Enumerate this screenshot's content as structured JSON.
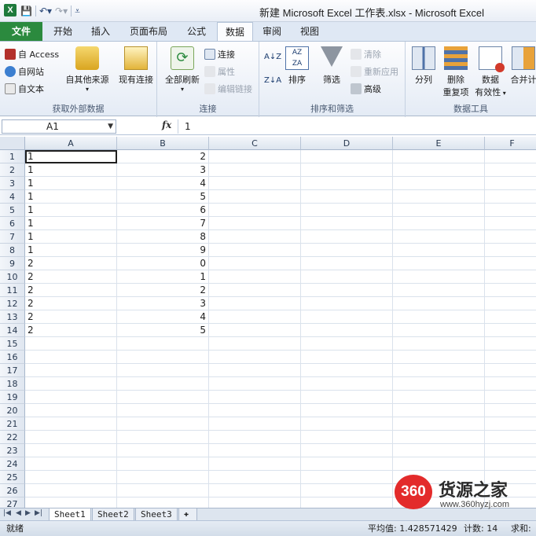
{
  "window": {
    "title": "新建 Microsoft Excel 工作表.xlsx - Microsoft Excel",
    "app_icon": "X"
  },
  "quick_access": {
    "save_icon": "save-icon",
    "undo_icon": "undo-icon",
    "redo_icon": "redo-icon",
    "customize_icon": "customize-qat-icon"
  },
  "ribbon_tabs": [
    {
      "label": "文件"
    },
    {
      "label": "开始"
    },
    {
      "label": "插入"
    },
    {
      "label": "页面布局"
    },
    {
      "label": "公式"
    },
    {
      "label": "数据"
    },
    {
      "label": "审阅"
    },
    {
      "label": "视图"
    }
  ],
  "ribbon": {
    "external": {
      "label": "获取外部数据",
      "access": "自 Access",
      "web": "自网站",
      "text": "自文本",
      "other": "自其他来源",
      "existing": "现有连接"
    },
    "connections": {
      "label": "连接",
      "refresh_all": "全部刷新",
      "connections": "连接",
      "properties": "属性",
      "edit_links": "编辑链接"
    },
    "sort_filter": {
      "label": "排序和筛选",
      "sort_asc": "A↓Z",
      "sort_desc": "Z↓A",
      "sort": "排序",
      "filter": "筛选",
      "clear": "清除",
      "reapply": "重新应用",
      "advanced": "高级"
    },
    "data_tools": {
      "label": "数据工具",
      "split": "分列",
      "remove_dup_1": "删除",
      "remove_dup_2": "重复项",
      "validation_1": "数据",
      "validation_2": "有效性",
      "consolidate": "合并计"
    }
  },
  "formula_bar": {
    "name_box": "A1",
    "fx": "fx",
    "value": "1"
  },
  "sheet": {
    "columns": [
      "A",
      "B",
      "C",
      "D",
      "E",
      "F"
    ],
    "rows": [
      {
        "n": "1",
        "a": "1",
        "b": "2"
      },
      {
        "n": "2",
        "a": "1",
        "b": "3"
      },
      {
        "n": "3",
        "a": "1",
        "b": "4"
      },
      {
        "n": "4",
        "a": "1",
        "b": "5"
      },
      {
        "n": "5",
        "a": "1",
        "b": "6"
      },
      {
        "n": "6",
        "a": "1",
        "b": "7"
      },
      {
        "n": "7",
        "a": "1",
        "b": "8"
      },
      {
        "n": "8",
        "a": "1",
        "b": "9"
      },
      {
        "n": "9",
        "a": "2",
        "b": "0"
      },
      {
        "n": "10",
        "a": "2",
        "b": "1"
      },
      {
        "n": "11",
        "a": "2",
        "b": "2"
      },
      {
        "n": "12",
        "a": "2",
        "b": "3"
      },
      {
        "n": "13",
        "a": "2",
        "b": "4"
      },
      {
        "n": "14",
        "a": "2",
        "b": "5"
      },
      {
        "n": "15",
        "a": "",
        "b": ""
      },
      {
        "n": "16",
        "a": "",
        "b": ""
      },
      {
        "n": "17",
        "a": "",
        "b": ""
      },
      {
        "n": "18",
        "a": "",
        "b": ""
      },
      {
        "n": "19",
        "a": "",
        "b": ""
      },
      {
        "n": "20",
        "a": "",
        "b": ""
      },
      {
        "n": "21",
        "a": "",
        "b": ""
      },
      {
        "n": "22",
        "a": "",
        "b": ""
      },
      {
        "n": "23",
        "a": "",
        "b": ""
      },
      {
        "n": "24",
        "a": "",
        "b": ""
      },
      {
        "n": "25",
        "a": "",
        "b": ""
      },
      {
        "n": "26",
        "a": "",
        "b": ""
      },
      {
        "n": "27",
        "a": "",
        "b": ""
      }
    ]
  },
  "sheet_tabs": [
    "Sheet1",
    "Sheet2",
    "Sheet3"
  ],
  "status": {
    "ready": "就绪",
    "average": "平均值: 1.428571429",
    "count": "计数: 14",
    "sum": "求和:"
  },
  "watermark": {
    "badge": "360",
    "name": "货源之家",
    "url": "www.360hyzj.com"
  },
  "colors": {
    "file_tab": "#2b8a3e",
    "excel_green": "#1e7a3c",
    "watermark_red": "#e32b2b"
  }
}
